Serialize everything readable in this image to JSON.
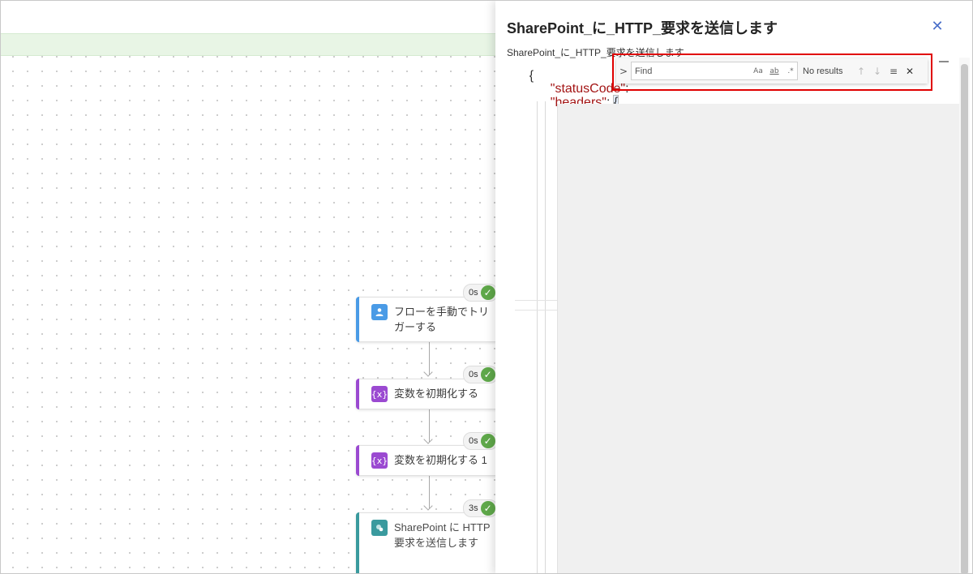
{
  "canvas": {
    "nodes": [
      {
        "label": "フローを手動でトリ\nガーする",
        "icon": "manual-trigger-icon",
        "duration": "0s"
      },
      {
        "label": "変数を初期化する",
        "icon": "variable-icon",
        "duration": "0s"
      },
      {
        "label": "変数を初期化する 1",
        "icon": "variable-icon",
        "duration": "0s"
      },
      {
        "label": "SharePoint に HTTP\n要求を送信します",
        "icon": "sharepoint-icon",
        "duration": "3s"
      }
    ],
    "icon_glyphs": {
      "variable": "{x}",
      "trigger": "👤",
      "sharepoint": "S"
    }
  },
  "panel": {
    "title": "SharePoint_に_HTTP_要求を送信します",
    "close_glyph": "✕",
    "subtitle": "SharePoint_に_HTTP_要求を送信します"
  },
  "editor": {
    "line1": "{",
    "line2_key": "\"statusCode\"",
    "line2_punct": ":",
    "line3_key": "\"headers\"",
    "line3_punct": ":",
    "line3_brace": "{"
  },
  "find": {
    "toggle_glyph": ">",
    "placeholder": "Find",
    "match_case": "Aa",
    "whole_word": "ab",
    "regex": ".*",
    "results": "No results",
    "prev_glyph": "↑",
    "next_glyph": "↓",
    "selection_glyph": "≡",
    "close_glyph": "✕"
  },
  "colors": {
    "accent_blue": "#4a9be6",
    "accent_purple": "#9b4ad1",
    "accent_teal": "#3a9a9e",
    "success_green": "#5fa84a",
    "highlight_red": "#e00000"
  }
}
